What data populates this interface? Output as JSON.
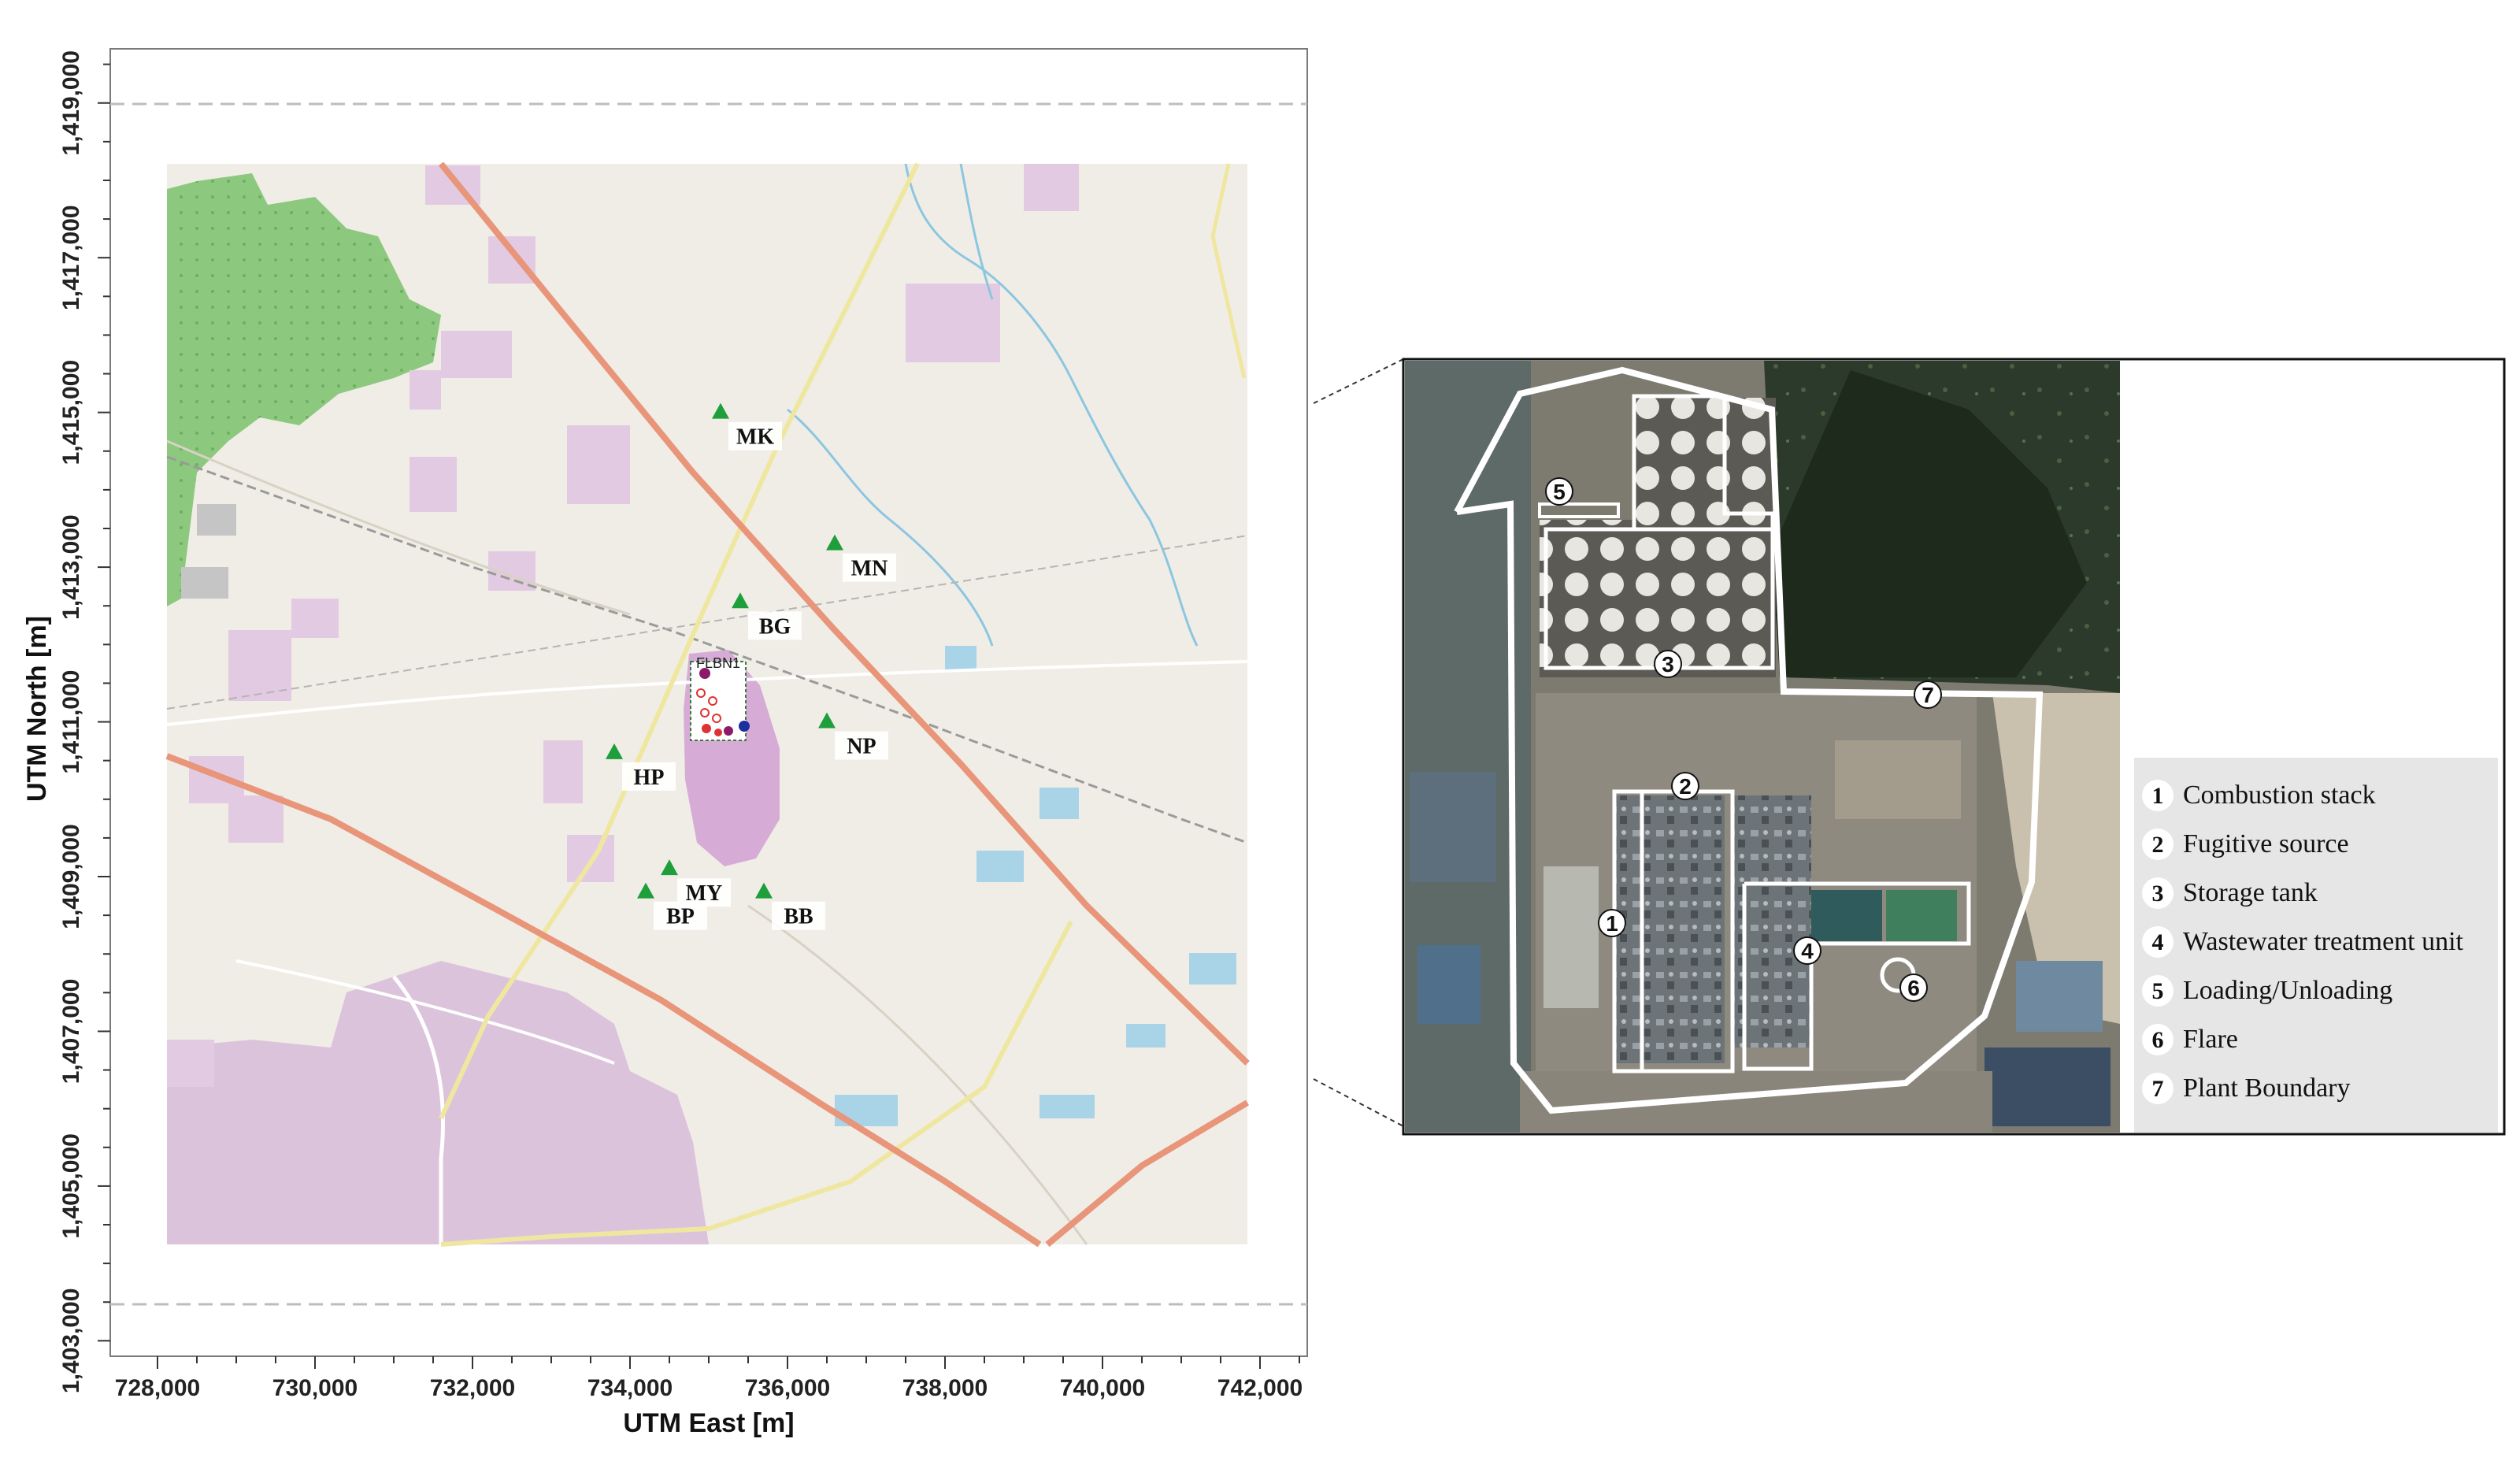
{
  "axes": {
    "x_title": "UTM East [m]",
    "y_title": "UTM North [m]",
    "x_ticks": [
      "728,000",
      "730,000",
      "732,000",
      "734,000",
      "736,000",
      "738,000",
      "740,000",
      "742,000"
    ],
    "y_ticks": [
      "1,419,000",
      "1,417,000",
      "1,415,000",
      "1,413,000",
      "1,411,000",
      "1,409,000",
      "1,407,000",
      "1,405,000",
      "1,403,000"
    ],
    "x_range": [
      727400,
      742600
    ],
    "y_range": [
      1402800,
      1419700
    ]
  },
  "stations": [
    {
      "label": "MK",
      "x": 735150,
      "y": 1415000
    },
    {
      "label": "MN",
      "x": 736600,
      "y": 1413300
    },
    {
      "label": "BG",
      "x": 735400,
      "y": 1412550
    },
    {
      "label": "HP",
      "x": 733800,
      "y": 1410600
    },
    {
      "label": "NP",
      "x": 736500,
      "y": 1411000
    },
    {
      "label": "MY",
      "x": 734500,
      "y": 1409100
    },
    {
      "label": "BP",
      "x": 734200,
      "y": 1408800
    },
    {
      "label": "BB",
      "x": 735700,
      "y": 1408800
    }
  ],
  "source_label": "FLBN1",
  "plant_zones": [
    {
      "num": "1",
      "name": "Combustion stack"
    },
    {
      "num": "2",
      "name": "Fugitive source"
    },
    {
      "num": "3",
      "name": "Storage tank"
    },
    {
      "num": "4",
      "name": "Wastewater treatment unit"
    },
    {
      "num": "5",
      "name": "Loading/Unloading"
    },
    {
      "num": "6",
      "name": "Flare"
    },
    {
      "num": "7",
      "name": "Plant Boundary"
    }
  ],
  "colors": {
    "station_marker": "#1f9e3c",
    "major_road": "#e8957a",
    "railway": "#9a9a9a",
    "forest": "#8cc97e",
    "urban": "#dcc3dc",
    "plant_boundary": "#ffffff"
  }
}
